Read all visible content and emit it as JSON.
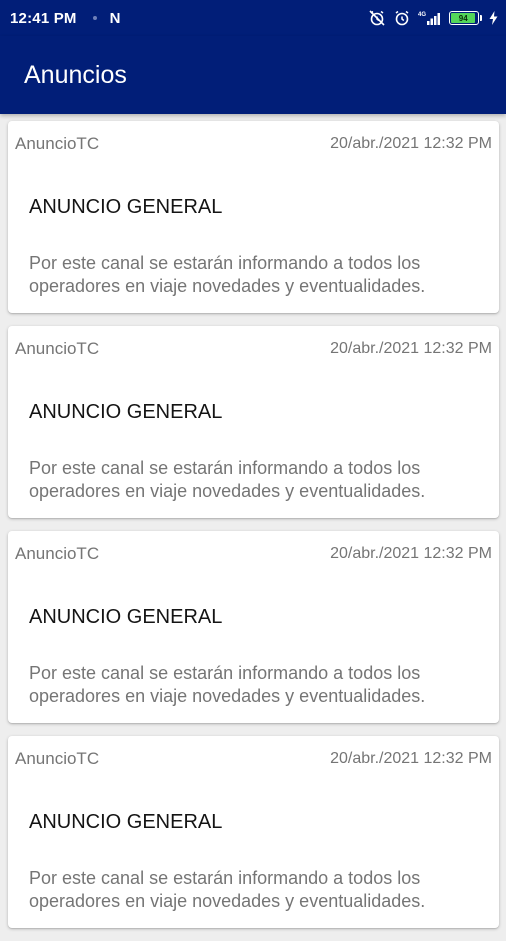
{
  "status_bar": {
    "time": "12:41 PM",
    "notification_icon": "n-icon",
    "network_label": "4G",
    "battery_level": "94",
    "battery_fraction": 0.94,
    "accent_color": "#011e78"
  },
  "app_bar": {
    "title": "Anuncios"
  },
  "announcements": [
    {
      "source": "AnuncioTC",
      "date": "20/abr./2021 12:32 PM",
      "title": "ANUNCIO GENERAL",
      "body": "Por este canal se estarán informando a todos los operadores en viaje novedades y eventualidades."
    },
    {
      "source": "AnuncioTC",
      "date": "20/abr./2021 12:32 PM",
      "title": "ANUNCIO GENERAL",
      "body": "Por este canal se estarán informando a todos los operadores en viaje novedades y eventualidades."
    },
    {
      "source": "AnuncioTC",
      "date": "20/abr./2021 12:32 PM",
      "title": "ANUNCIO GENERAL",
      "body": "Por este canal se estarán informando a todos los operadores en viaje novedades y eventualidades."
    },
    {
      "source": "AnuncioTC",
      "date": "20/abr./2021 12:32 PM",
      "title": "ANUNCIO GENERAL",
      "body": "Por este canal se estarán informando a todos los operadores en viaje novedades y eventualidades."
    }
  ]
}
